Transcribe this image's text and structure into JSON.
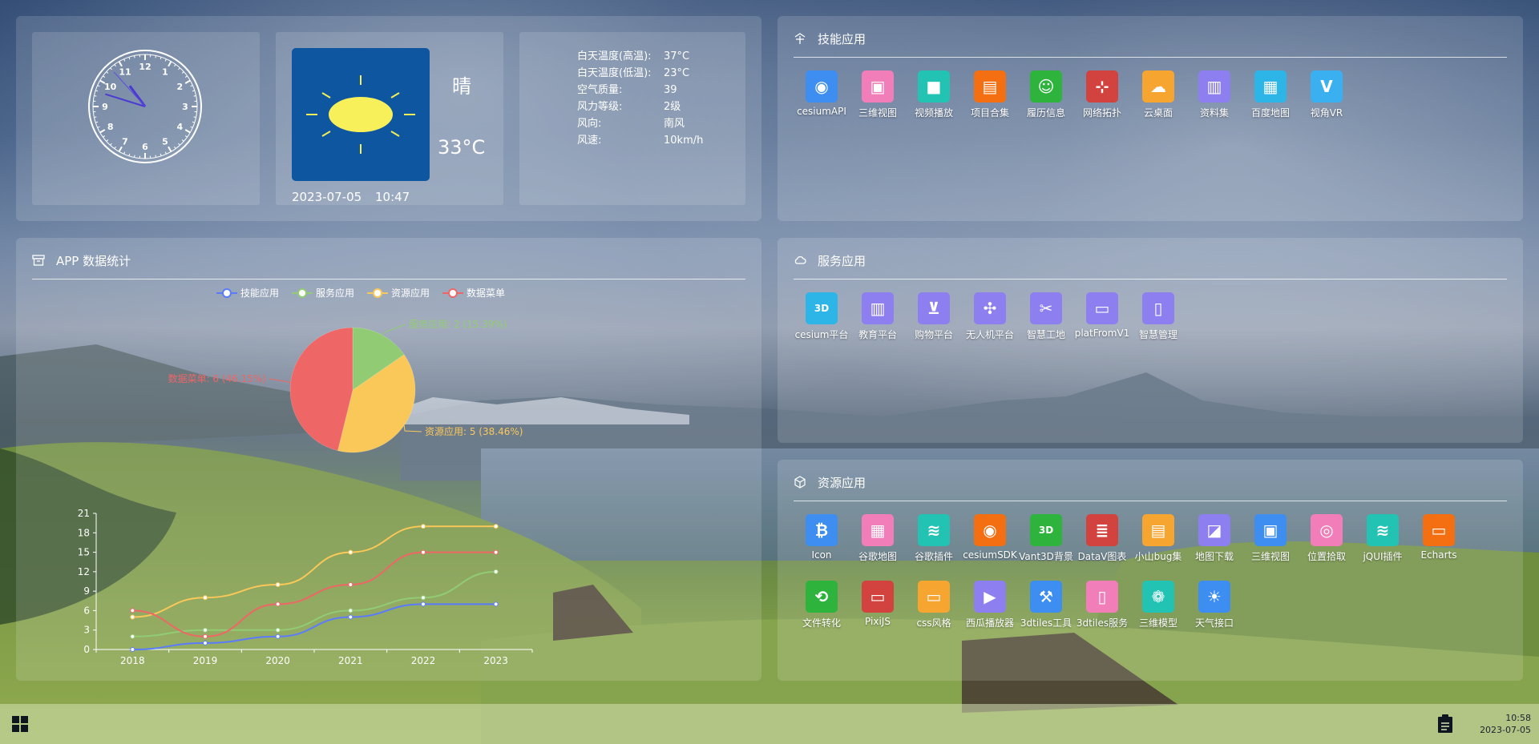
{
  "clock": {
    "hour": 10,
    "minute": 47,
    "second": 53,
    "numerals": [
      "12",
      "1",
      "2",
      "3",
      "4",
      "5",
      "6",
      "7",
      "8",
      "9",
      "10",
      "11"
    ]
  },
  "weather": {
    "condition": "晴",
    "temperature": "33°C",
    "date": "2023-07-05",
    "time": "10:47",
    "details": [
      {
        "key": "白天温度(高温):",
        "value": "37°C"
      },
      {
        "key": "白天温度(低温):",
        "value": "23°C"
      },
      {
        "key": "空气质量:",
        "value": "39"
      },
      {
        "key": "风力等级:",
        "value": "2级"
      },
      {
        "key": "风向:",
        "value": "南风"
      },
      {
        "key": "风速:",
        "value": "10km/h"
      }
    ]
  },
  "stats": {
    "title": "APP 数据统计",
    "legend": [
      {
        "name": "技能应用",
        "color": "#5b7bff"
      },
      {
        "name": "服务应用",
        "color": "#91cc75"
      },
      {
        "name": "资源应用",
        "color": "#fac858"
      },
      {
        "name": "数据菜单",
        "color": "#ee6666"
      }
    ]
  },
  "chart_data": [
    {
      "type": "pie",
      "slices": [
        {
          "name": "服务应用",
          "value": 2,
          "label": "服务应用: 2 (15.39%)",
          "color": "#91cc75"
        },
        {
          "name": "资源应用",
          "value": 5,
          "label": "资源应用: 5 (38.46%)",
          "color": "#fac858"
        },
        {
          "name": "数据菜单",
          "value": 6,
          "label": "数据菜单: 6 (46.15%)",
          "color": "#ee6666"
        }
      ]
    },
    {
      "type": "line",
      "categories": [
        "2018",
        "2019",
        "2020",
        "2021",
        "2022",
        "2023"
      ],
      "yticks": [
        "0",
        "3",
        "6",
        "9",
        "12",
        "15",
        "18",
        "21"
      ],
      "ylim": [
        0,
        21
      ],
      "series": [
        {
          "name": "技能应用",
          "color": "#5b7bff",
          "values": [
            0,
            1,
            2,
            5,
            7,
            7
          ]
        },
        {
          "name": "服务应用",
          "color": "#91cc75",
          "values": [
            2,
            3,
            3,
            6,
            8,
            12
          ]
        },
        {
          "name": "资源应用",
          "color": "#fac858",
          "values": [
            5,
            8,
            10,
            15,
            19,
            19
          ]
        },
        {
          "name": "数据菜单",
          "color": "#ee6666",
          "values": [
            6,
            2,
            7,
            10,
            15,
            15
          ]
        }
      ]
    }
  ],
  "skill": {
    "title": "技能应用",
    "apps": [
      {
        "label": "cesiumAPI",
        "color": "#3d8ef0",
        "glyph": "◉"
      },
      {
        "label": "三维视图",
        "color": "#f27eb9",
        "glyph": "▣"
      },
      {
        "label": "视频播放",
        "color": "#22c3b3",
        "glyph": "■"
      },
      {
        "label": "项目合集",
        "color": "#f36f12",
        "glyph": "▤"
      },
      {
        "label": "履历信息",
        "color": "#2eb33d",
        "glyph": "☺"
      },
      {
        "label": "网络拓扑",
        "color": "#d2433f",
        "glyph": "⊹"
      },
      {
        "label": "云桌面",
        "color": "#f7a531",
        "glyph": "☁"
      },
      {
        "label": "资料集",
        "color": "#8d7ff0",
        "glyph": "▥"
      },
      {
        "label": "百度地图",
        "color": "#2db5e8",
        "glyph": "▦"
      },
      {
        "label": "视角VR",
        "color": "#3ab0f0",
        "glyph": "V"
      }
    ]
  },
  "service": {
    "title": "服务应用",
    "apps": [
      {
        "label": "cesium平台",
        "color": "#2db5e8",
        "glyph": "3D"
      },
      {
        "label": "教育平台",
        "color": "#8d7ff0",
        "glyph": "▥"
      },
      {
        "label": "购物平台",
        "color": "#8d7ff0",
        "glyph": "⊻"
      },
      {
        "label": "无人机平台",
        "color": "#8d7ff0",
        "glyph": "✣"
      },
      {
        "label": "智慧工地",
        "color": "#8d7ff0",
        "glyph": "✂"
      },
      {
        "label": "platFromV1",
        "color": "#8d7ff0",
        "glyph": "▭"
      },
      {
        "label": "智慧管理",
        "color": "#8d7ff0",
        "glyph": "▯"
      }
    ]
  },
  "resource": {
    "title": "资源应用",
    "apps": [
      {
        "label": "Icon",
        "color": "#3d8ef0",
        "glyph": "₿"
      },
      {
        "label": "谷歌地图",
        "color": "#f27eb9",
        "glyph": "▦"
      },
      {
        "label": "谷歌插件",
        "color": "#22c3b3",
        "glyph": "≋"
      },
      {
        "label": "cesiumSDK",
        "color": "#f36f12",
        "glyph": "◉"
      },
      {
        "label": "Vant3D背景",
        "color": "#2eb33d",
        "glyph": "3D"
      },
      {
        "label": "DataV图表",
        "color": "#d2433f",
        "glyph": "≣"
      },
      {
        "label": "小山bug集",
        "color": "#f7a531",
        "glyph": "▤"
      },
      {
        "label": "地图下载",
        "color": "#8d7ff0",
        "glyph": "◪"
      },
      {
        "label": "三维视图",
        "color": "#3d8ef0",
        "glyph": "▣"
      },
      {
        "label": "位置拾取",
        "color": "#f27eb9",
        "glyph": "◎"
      },
      {
        "label": "jQUI插件",
        "color": "#22c3b3",
        "glyph": "≋"
      },
      {
        "label": "Echarts",
        "color": "#f36f12",
        "glyph": "▭"
      },
      {
        "label": "文件转化",
        "color": "#2eb33d",
        "glyph": "⟲"
      },
      {
        "label": "PixiJS",
        "color": "#d2433f",
        "glyph": "▭"
      },
      {
        "label": "css风格",
        "color": "#f7a531",
        "glyph": "▭"
      },
      {
        "label": "西瓜播放器",
        "color": "#8d7ff0",
        "glyph": "▶"
      },
      {
        "label": "3dtiles工具",
        "color": "#3d8ef0",
        "glyph": "⚒"
      },
      {
        "label": "3dtiles服务",
        "color": "#f27eb9",
        "glyph": "▯"
      },
      {
        "label": "三维模型",
        "color": "#22c3b3",
        "glyph": "❁"
      },
      {
        "label": "天气接口",
        "color": "#3d8ef0",
        "glyph": "☀"
      }
    ]
  },
  "taskbar": {
    "time": "10:58",
    "date": "2023-07-05",
    "start_icon": "windows-icon",
    "tray_icon": "clipboard-icon"
  }
}
